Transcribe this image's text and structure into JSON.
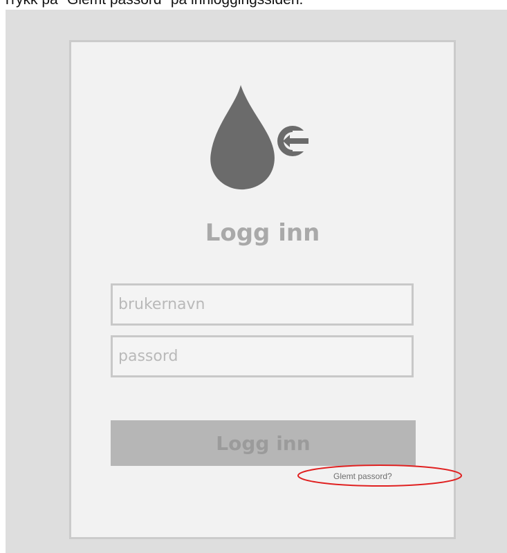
{
  "instruction": {
    "text": "Trykk på \"Glemt passord\" på innloggingssiden."
  },
  "login": {
    "logo_icon": "water-drop-login-icon",
    "title": "Logg inn",
    "username_placeholder": "brukernavn",
    "password_placeholder": "passord",
    "submit_label": "Logg inn",
    "forgot_password_label": "Glemt passord?"
  },
  "annotation": {
    "shape": "ellipse",
    "color": "#e02020",
    "target": "Glemt passord?"
  },
  "colors": {
    "page_background": "#dedede",
    "card_background": "#f2f2f2",
    "logo": "#6b6b6b",
    "title": "#a9a9a9",
    "button_background": "#b6b6b6"
  }
}
